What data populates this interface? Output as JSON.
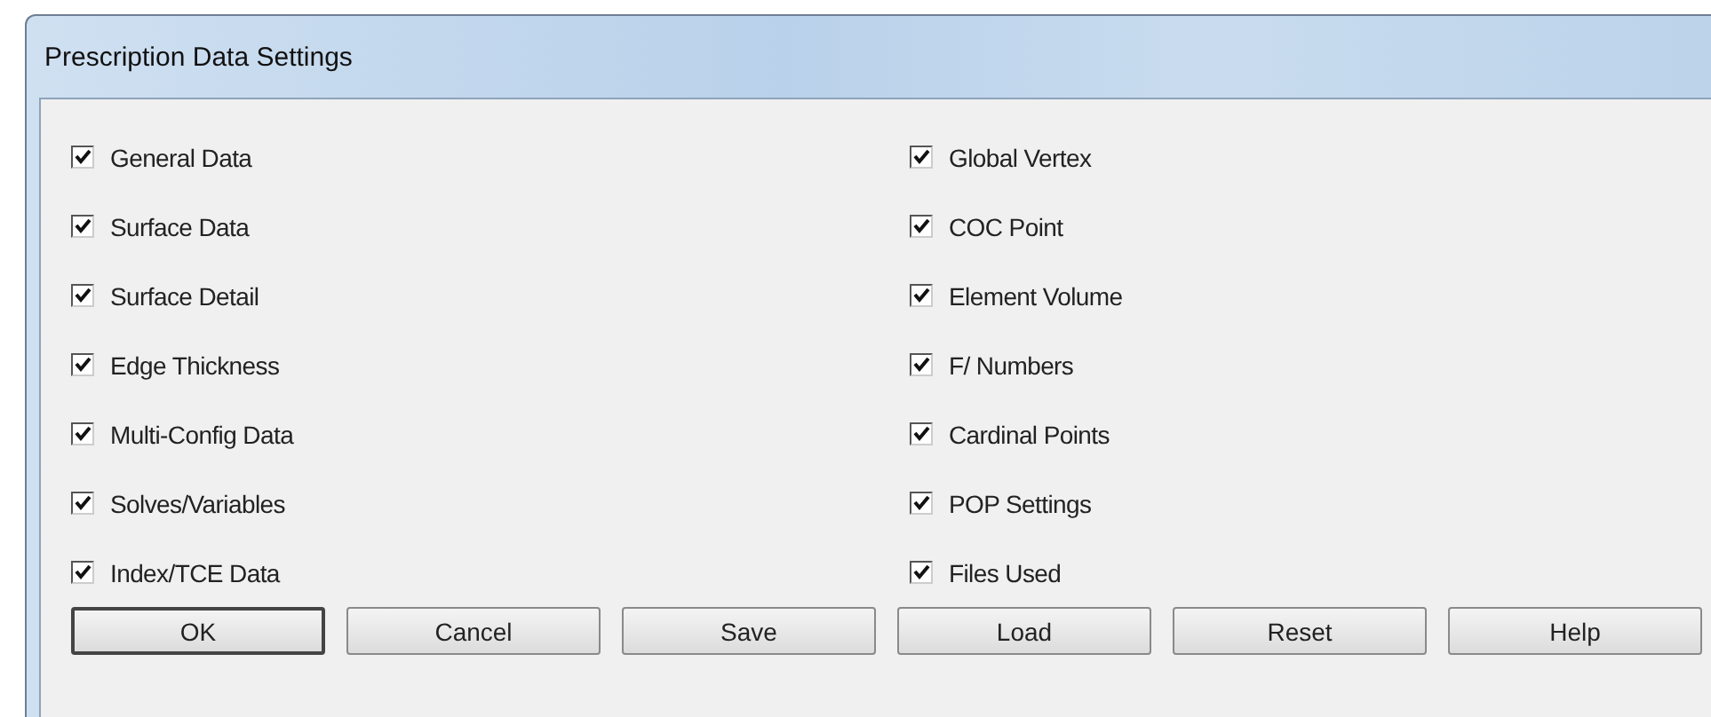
{
  "window": {
    "title": "Prescription Data Settings"
  },
  "options": [
    {
      "label": "General Data",
      "checked": true
    },
    {
      "label": "Global Vertex",
      "checked": true
    },
    {
      "label": "Surface Data",
      "checked": true
    },
    {
      "label": "COC Point",
      "checked": true
    },
    {
      "label": "Surface Detail",
      "checked": true
    },
    {
      "label": "Element Volume",
      "checked": true
    },
    {
      "label": "Edge Thickness",
      "checked": true
    },
    {
      "label": "F/ Numbers",
      "checked": true
    },
    {
      "label": "Multi-Config Data",
      "checked": true
    },
    {
      "label": "Cardinal Points",
      "checked": true
    },
    {
      "label": "Solves/Variables",
      "checked": true
    },
    {
      "label": "POP Settings",
      "checked": true
    },
    {
      "label": "Index/TCE Data",
      "checked": true
    },
    {
      "label": "Files Used",
      "checked": true
    }
  ],
  "buttons": [
    {
      "label": "OK",
      "selected": true
    },
    {
      "label": "Cancel",
      "selected": false
    },
    {
      "label": "Save",
      "selected": false
    },
    {
      "label": "Load",
      "selected": false
    },
    {
      "label": "Reset",
      "selected": false
    },
    {
      "label": "Help",
      "selected": false
    }
  ]
}
